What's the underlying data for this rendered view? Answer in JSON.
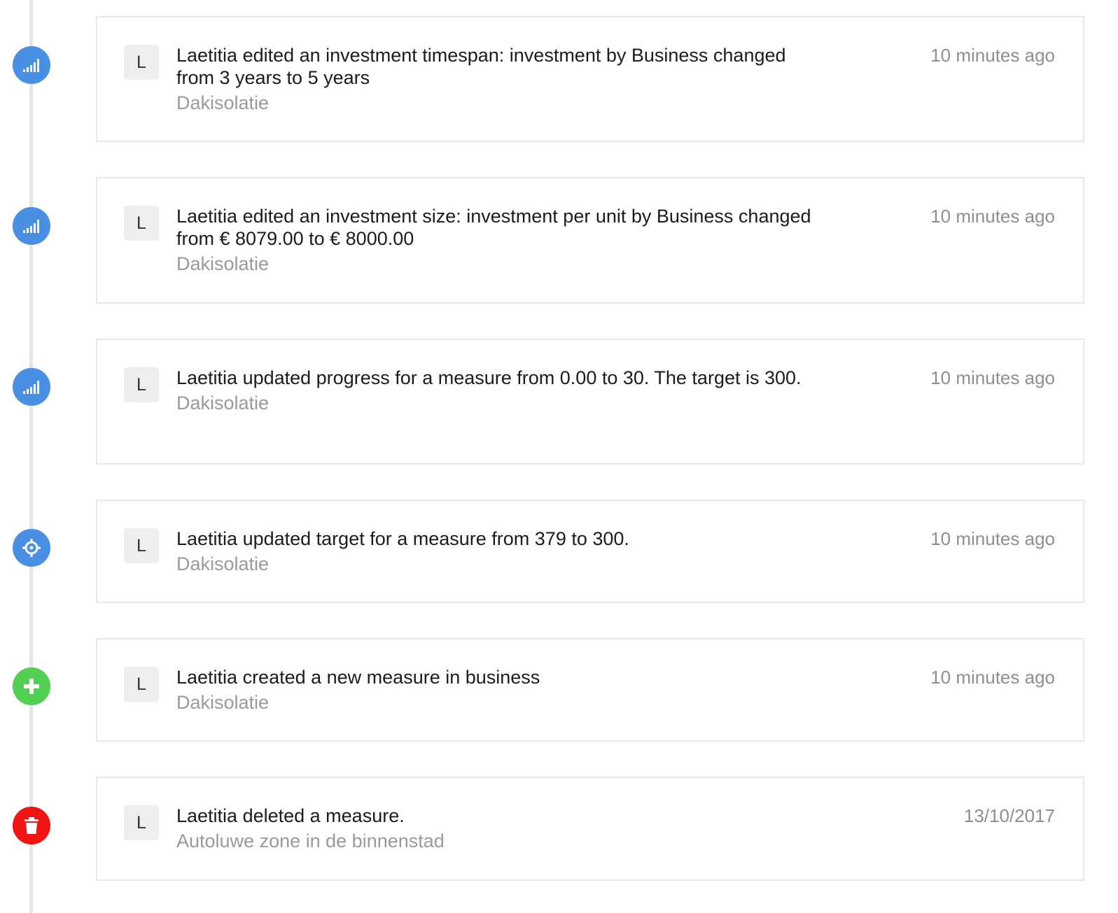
{
  "colors": {
    "info": "#4a90e2",
    "success": "#53cf53",
    "danger": "#f21313",
    "line": "#e6e6e6"
  },
  "events": [
    {
      "icon": "bar-chart-icon",
      "avatar": "L",
      "message": "Laetitia edited an investment timespan: investment by Business changed from 3 years to 5 years",
      "project": "Dakisolatie",
      "time": "10 minutes ago"
    },
    {
      "icon": "bar-chart-icon",
      "avatar": "L",
      "message": "Laetitia edited an investment size: investment per unit by Business changed from € 8079.00 to € 8000.00",
      "project": "Dakisolatie",
      "time": "10 minutes ago"
    },
    {
      "icon": "bar-chart-icon",
      "avatar": "L",
      "message": "Laetitia updated progress for a measure from 0.00 to 30. The target is 300.",
      "project": "Dakisolatie",
      "time": "10 minutes ago"
    },
    {
      "icon": "target-icon",
      "avatar": "L",
      "message": "Laetitia updated target for a measure from 379 to 300.",
      "project": "Dakisolatie",
      "time": "10 minutes ago"
    },
    {
      "icon": "plus-icon",
      "avatar": "L",
      "message": "Laetitia created a new measure in business",
      "project": "Dakisolatie",
      "time": "10 minutes ago"
    },
    {
      "icon": "trash-icon",
      "avatar": "L",
      "message": "Laetitia deleted a measure.",
      "project": "Autoluwe zone in de binnenstad",
      "time": "13/10/2017"
    }
  ]
}
